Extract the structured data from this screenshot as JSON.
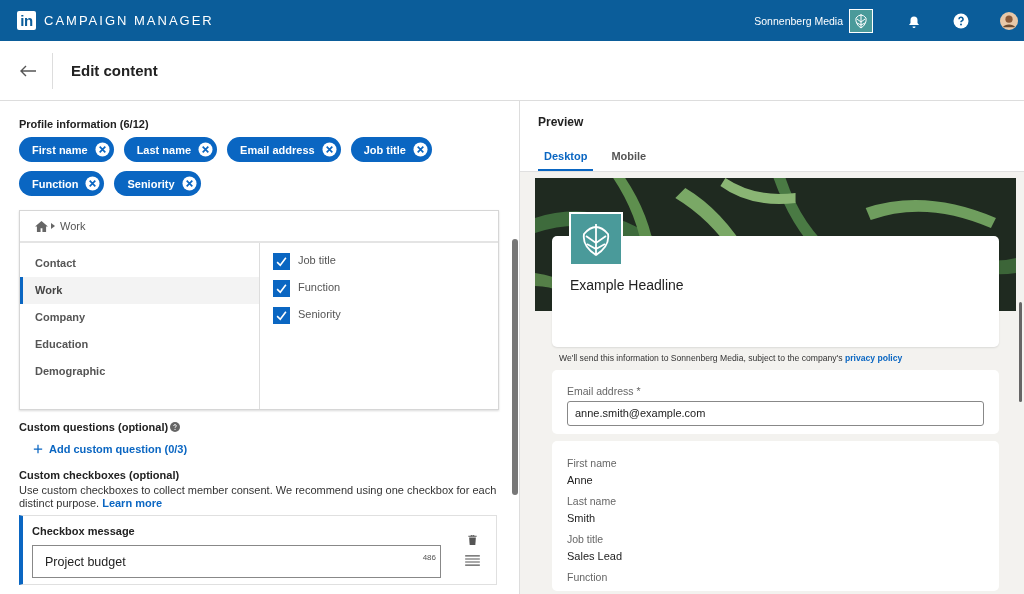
{
  "header": {
    "logo": "in",
    "title": "CAMPAIGN MANAGER",
    "account": "Sonnenberg Media"
  },
  "page": {
    "title": "Edit content"
  },
  "profile": {
    "label": "Profile information (6/12)",
    "chips": [
      "First name",
      "Last name",
      "Email address",
      "Job title",
      "Function",
      "Seniority"
    ]
  },
  "picker": {
    "breadcrumb": "Work",
    "categories": [
      {
        "label": "Contact",
        "selected": false
      },
      {
        "label": "Work",
        "selected": true
      },
      {
        "label": "Company",
        "selected": false
      },
      {
        "label": "Education",
        "selected": false
      },
      {
        "label": "Demographic",
        "selected": false
      }
    ],
    "fields": [
      {
        "label": "Job title",
        "checked": true
      },
      {
        "label": "Function",
        "checked": true
      },
      {
        "label": "Seniority",
        "checked": true
      }
    ]
  },
  "custom_questions": {
    "label": "Custom questions (optional)",
    "add": "Add custom question (0/3)"
  },
  "custom_checkboxes": {
    "label": "Custom checkboxes (optional)",
    "description": "Use custom checkboxes to collect member consent. We recommend using one checkbox for each distinct purpose.",
    "link": "Learn more",
    "card": {
      "label": "Checkbox message",
      "value": "Project budget",
      "counter": "486"
    }
  },
  "preview": {
    "title": "Preview",
    "tabs": [
      {
        "label": "Desktop",
        "selected": true
      },
      {
        "label": "Mobile",
        "selected": false
      }
    ],
    "headline": "Example Headline",
    "notice": "We'll send this information to Sonnenberg Media, subject to the company's",
    "notice_link": "privacy policy",
    "email": {
      "label": "Email address *",
      "value": "anne.smith@example.com"
    },
    "details": [
      {
        "label": "First name",
        "value": "Anne"
      },
      {
        "label": "Last name",
        "value": "Smith"
      },
      {
        "label": "Job title",
        "value": "Sales Lead"
      },
      {
        "label": "Function"
      }
    ]
  }
}
